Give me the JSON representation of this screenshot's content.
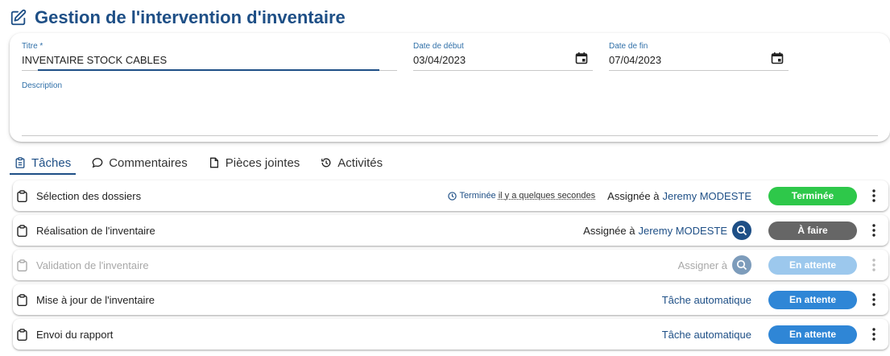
{
  "page": {
    "title": "Gestion de l'intervention d'inventaire"
  },
  "form": {
    "title_label": "Titre *",
    "title_value": "INVENTAIRE STOCK CABLES",
    "start_label": "Date de début",
    "start_value": "03/04/2023",
    "end_label": "Date de fin",
    "end_value": "07/04/2023",
    "description_label": "Description",
    "description_value": ""
  },
  "tabs": [
    {
      "label": "Tâches",
      "icon": "clipboard-icon",
      "active": true
    },
    {
      "label": "Commentaires",
      "icon": "comment-icon"
    },
    {
      "label": "Pièces jointes",
      "icon": "file-icon"
    },
    {
      "label": "Activités",
      "icon": "history-icon"
    }
  ],
  "tasks": [
    {
      "name": "Sélection des dossiers",
      "done_label": "Terminée",
      "done_relative": "il y a quelques secondes",
      "assign_label": "Assignée à",
      "assignee": "Jeremy MODESTE",
      "status": "Terminée"
    },
    {
      "name": "Réalisation de l'inventaire",
      "assign_label": "Assignée à",
      "assignee": "Jeremy MODESTE",
      "status": "À faire"
    },
    {
      "name": "Validation de l'inventaire",
      "assign_label": "Assigner à",
      "status": "En attente"
    },
    {
      "name": "Mise à jour de l'inventaire",
      "auto_label": "Tâche automatique",
      "status": "En attente"
    },
    {
      "name": "Envoi du rapport",
      "auto_label": "Tâche automatique",
      "status": "En attente"
    }
  ],
  "colors": {
    "primary": "#1e4f86",
    "status_done": "#2ec84a",
    "status_todo": "#666666",
    "status_waiting": "#2f86d6",
    "status_waiting_disabled": "#9cc8ed"
  }
}
